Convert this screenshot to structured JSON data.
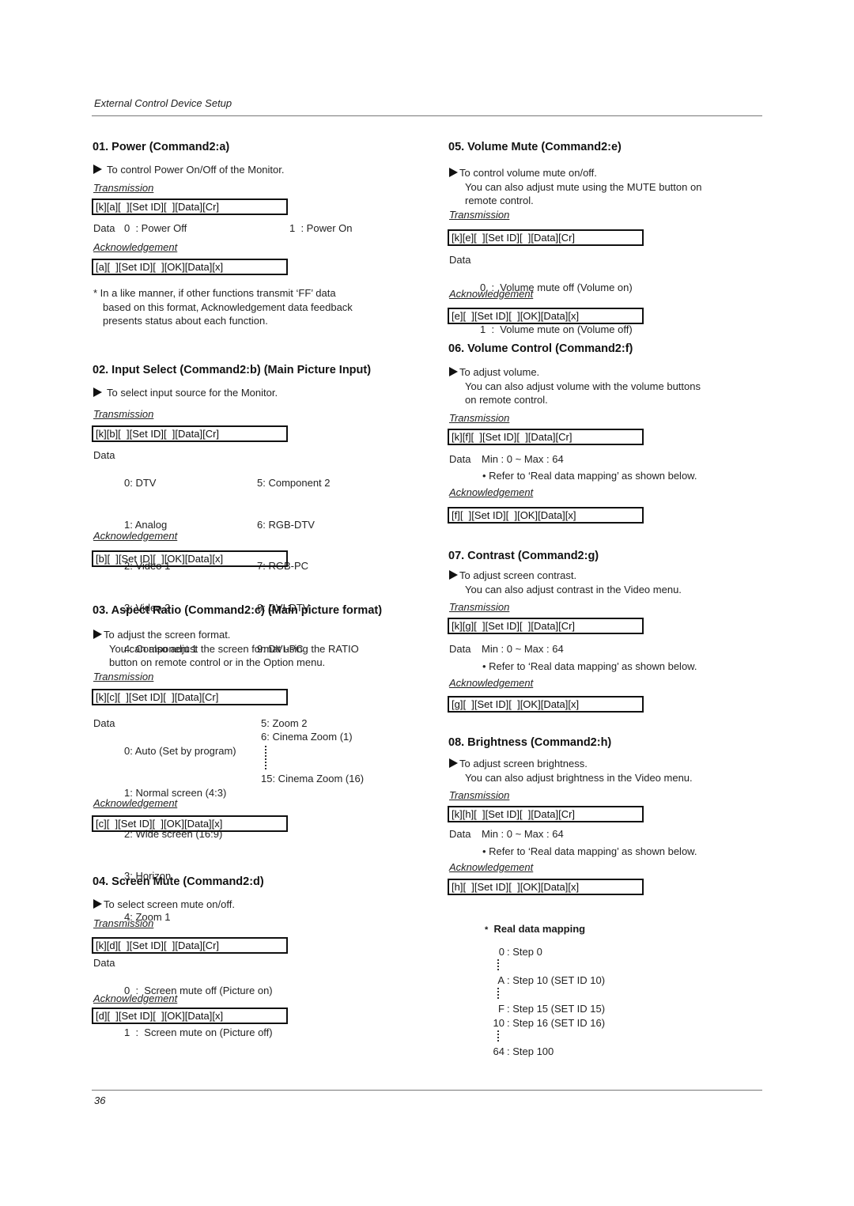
{
  "header": {
    "title": "External Control Device Setup"
  },
  "footer": {
    "page_number": "36"
  },
  "sections": {
    "power": {
      "title": "01. Power (Command2:a)",
      "desc": [
        "To control Power On/Off of the Monitor."
      ],
      "transmission_label": "Transmission",
      "transmission": "[k][a][  ][Set ID][  ][Data][Cr]",
      "data_label": "Data",
      "data": [
        "0  : Power Off",
        "1  : Power On"
      ],
      "ack_label": "Acknowledgement",
      "ack": "[a][  ][Set ID][  ][OK][Data][x]",
      "note": [
        "* In a like manner, if other functions transmit ‘FF’ data",
        "based on this format, Acknowledgement data feedback",
        "presents status about each function."
      ]
    },
    "input_select": {
      "title": "02. Input Select (Command2:b) (Main Picture Input)",
      "desc": [
        "To select input source for the Monitor."
      ],
      "transmission_label": "Transmission",
      "transmission": "[k][b][  ][Set ID][  ][Data][Cr]",
      "data_label": "Data",
      "data_left": [
        "0: DTV",
        "1: Analog",
        "2: Video 1",
        "3: Video 2",
        "4: Component 1"
      ],
      "data_right": [
        "5: Component 2",
        "6: RGB-DTV",
        "7: RGB-PC",
        "8: DVI-DTV",
        "9: DVI-PC"
      ],
      "ack_label": "Acknowledgement",
      "ack": "[b][  ][Set ID][  ][OK][Data][x]"
    },
    "aspect_ratio": {
      "title": "03. Aspect Ratio (Command2:c) (Main picture format)",
      "desc": [
        "To adjust the screen format.",
        "You can also adjust the screen format using the RATIO",
        "button on remote control or in the Option menu."
      ],
      "transmission_label": "Transmission",
      "transmission": "[k][c][  ][Set ID][  ][Data][Cr]",
      "data_label": "Data",
      "data_left": [
        "0: Auto (Set by program)",
        "1: Normal screen (4:3)",
        "2: Wide screen (16:9)",
        "3: Horizon",
        "4: Zoom 1"
      ],
      "data_right": [
        "5: Zoom 2",
        "6: Cinema Zoom (1)",
        "15: Cinema Zoom (16)"
      ],
      "ack_label": "Acknowledgement",
      "ack": "[c][  ][Set ID][  ][OK][Data][x]"
    },
    "screen_mute": {
      "title": "04. Screen Mute (Command2:d)",
      "desc": [
        "To select screen mute on/off."
      ],
      "transmission_label": "Transmission",
      "transmission": "[k][d][  ][Set ID][  ][Data][Cr]",
      "data_label": "Data",
      "data": [
        "0  :  Screen mute off (Picture on)",
        "1  :  Screen mute on (Picture off)"
      ],
      "ack_label": "Acknowledgement",
      "ack": "[d][  ][Set ID][  ][OK][Data][x]"
    },
    "volume_mute": {
      "title": "05. Volume Mute (Command2:e)",
      "desc": [
        "To control volume mute on/off.",
        "You can also adjust mute using the MUTE button on",
        "remote control."
      ],
      "transmission_label": "Transmission",
      "transmission": "[k][e][  ][Set ID][  ][Data][Cr]",
      "data_label": "Data",
      "data": [
        "0  :  Volume mute off (Volume on)",
        "1  :  Volume mute on (Volume off)"
      ],
      "ack_label": "Acknowledgement",
      "ack": "[e][  ][Set ID][  ][OK][Data][x]"
    },
    "volume_control": {
      "title": "06. Volume Control (Command2:f)",
      "desc": [
        "To adjust volume.",
        "You can also adjust volume with the volume buttons",
        "on remote control."
      ],
      "transmission_label": "Transmission",
      "transmission": "[k][f][  ][Set ID][  ][Data][Cr]",
      "data_label": "Data",
      "data": "Min : 0 ~ Max : 64",
      "bullet": "Refer to ‘Real data mapping’ as shown below.",
      "ack_label": "Acknowledgement",
      "ack": "[f][  ][Set ID][  ][OK][Data][x]"
    },
    "contrast": {
      "title": "07. Contrast (Command2:g)",
      "desc": [
        "To adjust screen contrast.",
        "You can also adjust contrast in the Video menu."
      ],
      "transmission_label": "Transmission",
      "transmission": "[k][g][  ][Set ID][  ][Data][Cr]",
      "data_label": "Data",
      "data": "Min : 0 ~ Max : 64",
      "bullet": "Refer to ‘Real data mapping’ as shown below.",
      "ack_label": "Acknowledgement",
      "ack": "[g][  ][Set ID][  ][OK][Data][x]"
    },
    "brightness": {
      "title": "08. Brightness (Command2:h)",
      "desc": [
        "To adjust screen brightness.",
        "You can also adjust brightness in the Video menu."
      ],
      "transmission_label": "Transmission",
      "transmission": "[k][h][  ][Set ID][  ][Data][Cr]",
      "data_label": "Data",
      "data": "Min : 0 ~ Max : 64",
      "bullet": "Refer to ‘Real data mapping’ as shown below.",
      "ack_label": "Acknowledgement",
      "ack": "[h][  ][Set ID][  ][OK][Data][x]"
    }
  },
  "mapping": {
    "title": "Real data mapping",
    "star": "*",
    "rows": [
      {
        "key": "0",
        "value": ": Step 0"
      },
      {
        "key": "A",
        "value": ": Step 10 (SET ID 10)"
      },
      {
        "key": "F",
        "value": ": Step 15 (SET ID 15)"
      },
      {
        "key": "10",
        "value": ": Step 16 (SET ID 16)"
      },
      {
        "key": "64",
        "value": ": Step 100"
      }
    ]
  }
}
